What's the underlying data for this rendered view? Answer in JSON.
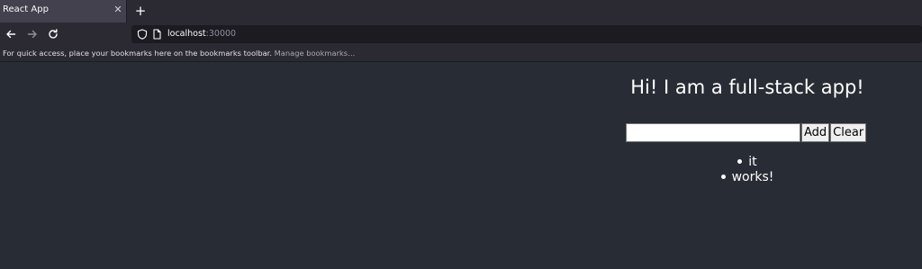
{
  "browser": {
    "tab": {
      "title": "React App",
      "close_icon": "close-icon"
    },
    "new_tab_icon": "plus-icon",
    "nav": {
      "back_icon": "arrow-left-icon",
      "forward_icon": "arrow-right-icon",
      "reload_icon": "reload-icon"
    },
    "url": {
      "host": "localhost",
      "port": ":30000",
      "shield_icon": "shield-icon",
      "page_icon": "page-icon"
    },
    "bookmarks": {
      "message": "For quick access, place your bookmarks here on the bookmarks toolbar.",
      "manage_link": "Manage bookmarks…"
    },
    "colors": {
      "chrome": "#2b2a33",
      "url_field": "#1c1b22",
      "page_background": "#282c34"
    }
  },
  "app": {
    "heading": "Hi! I am a full-stack app!",
    "input_value": "",
    "add_label": "Add",
    "clear_label": "Clear",
    "items": [
      "it",
      "works!"
    ]
  }
}
